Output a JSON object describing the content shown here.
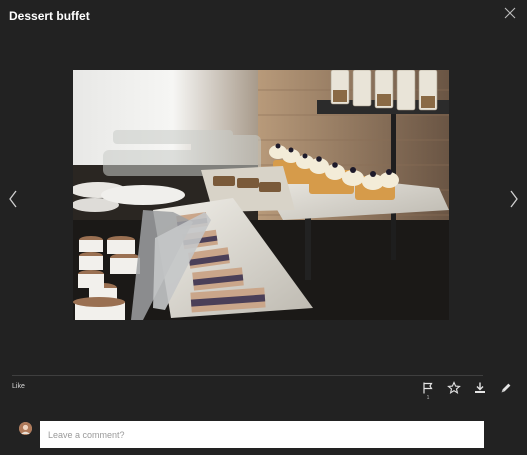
{
  "header": {
    "title": "Dessert buffet"
  },
  "icons": {
    "close": "close-icon",
    "prev": "chevron-left-icon",
    "next": "chevron-right-icon",
    "flag": "flag-icon",
    "star": "star-icon",
    "download": "download-icon",
    "edit": "pencil-icon"
  },
  "photo": {
    "subject": "dessert buffet photo"
  },
  "footer": {
    "like_label": "Like",
    "flag_count": "1"
  },
  "comment": {
    "placeholder": "Leave a comment?"
  },
  "colors": {
    "background": "#222222",
    "divider": "#3f3f3f",
    "text": "#ffffff",
    "input_bg": "#ffffff"
  }
}
